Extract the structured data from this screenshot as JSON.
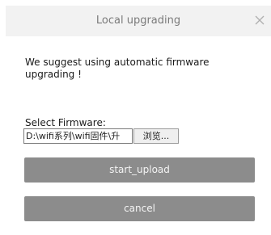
{
  "dialog": {
    "title": "Local upgrading",
    "close_icon": "close-icon",
    "message": "We suggest using automatic firmware upgrading !",
    "select_label": "Select Firmware:",
    "file_value": "D:\\wifi系列\\wifi固件\\升",
    "browse_label": "浏览...",
    "upload_label": "start_upload",
    "cancel_label": "cancel"
  },
  "colors": {
    "title_bar": "#f2f2f2",
    "button_bg": "#8c8c8c",
    "button_text": "#f4f4f4"
  }
}
